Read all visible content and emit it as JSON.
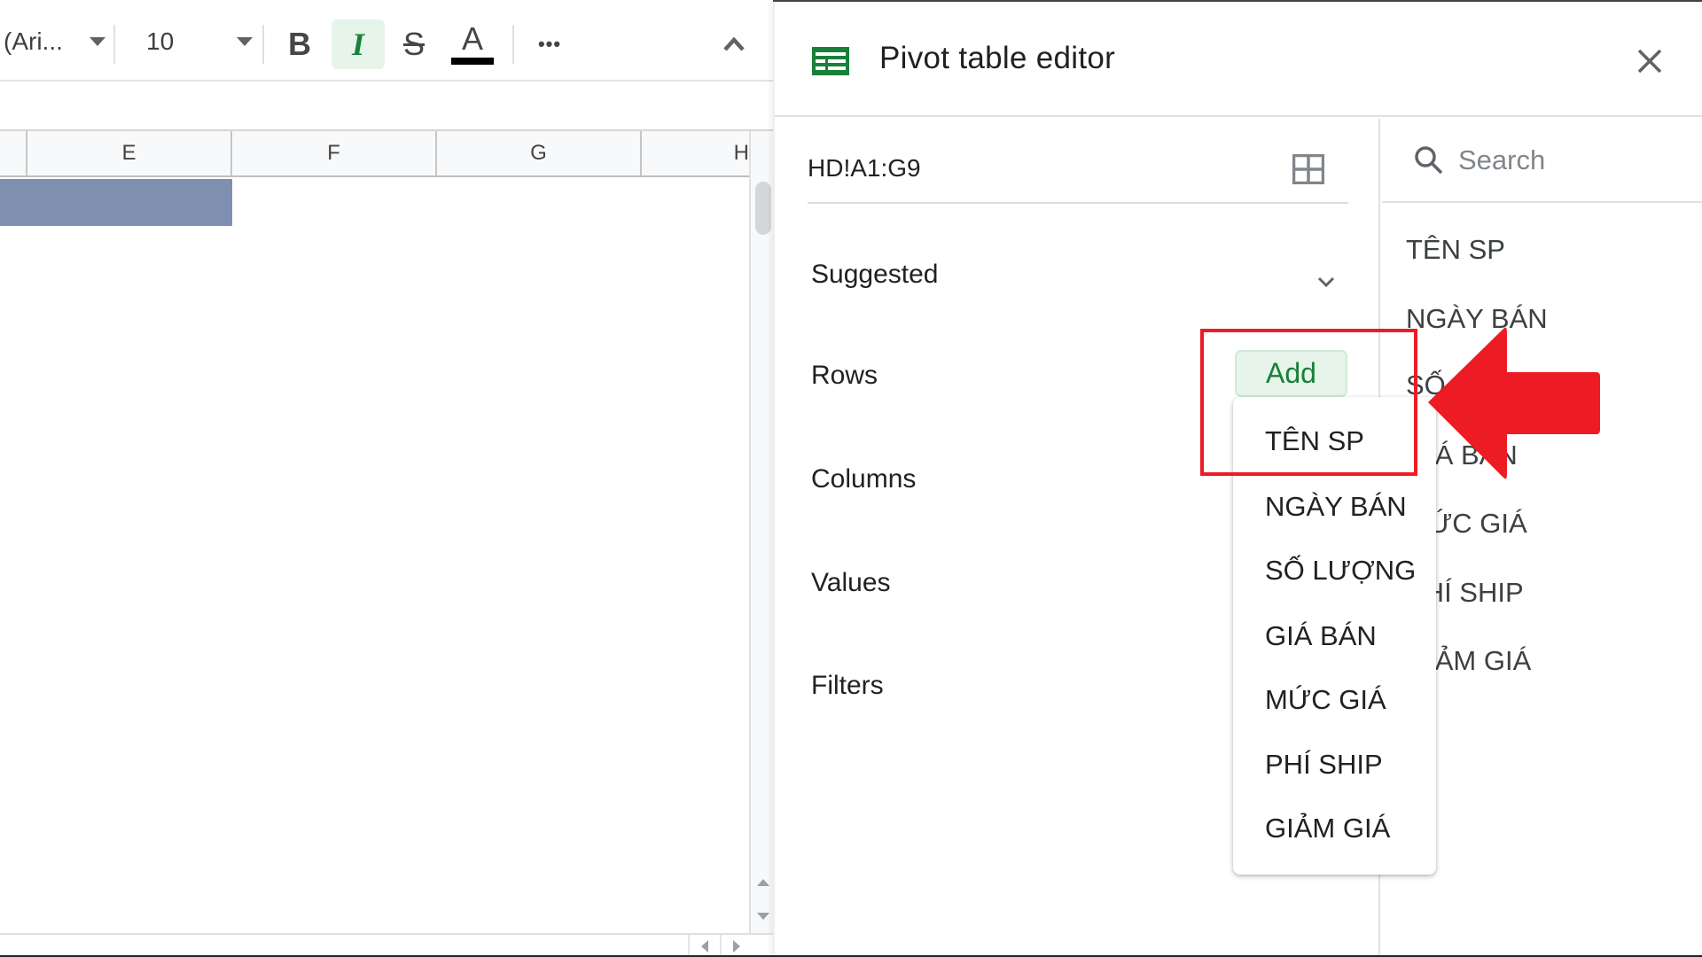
{
  "toolbar": {
    "font_name": "(Ari...",
    "font_size": "10",
    "bold_label": "B",
    "italic_label": "I",
    "strikethrough_label": "S",
    "text_color_label": "A",
    "text_color": "#000000",
    "more_label": "•••",
    "italic_active": true
  },
  "sheet": {
    "columns": [
      "E",
      "F",
      "G",
      "H"
    ],
    "selected_color": "#7e8fb0"
  },
  "panel": {
    "title": "Pivot table editor",
    "range": "HD!A1:G9",
    "sections": {
      "suggested": "Suggested",
      "rows": "Rows",
      "columns": "Columns",
      "values": "Values",
      "filters": "Filters"
    },
    "add_button": "Add",
    "search_placeholder": "Search",
    "fields": [
      "TÊN SP",
      "NGÀY BÁN",
      "SỐ LƯỢNG",
      "GIÁ BÁN",
      "MỨC GIÁ",
      "PHÍ SHIP",
      "GIẢM GIÁ"
    ],
    "accent_color": "#188038"
  },
  "dropdown": {
    "items": [
      "TÊN SP",
      "NGÀY BÁN",
      "SỐ LƯỢNG",
      "GIÁ BÁN",
      "MỨC GIÁ",
      "PHÍ SHIP",
      "GIẢM GIÁ"
    ]
  },
  "annotation": {
    "highlight_color": "#ed1c24",
    "arrow_color": "#ed1c24",
    "highlighted_item": "TÊN SP"
  }
}
